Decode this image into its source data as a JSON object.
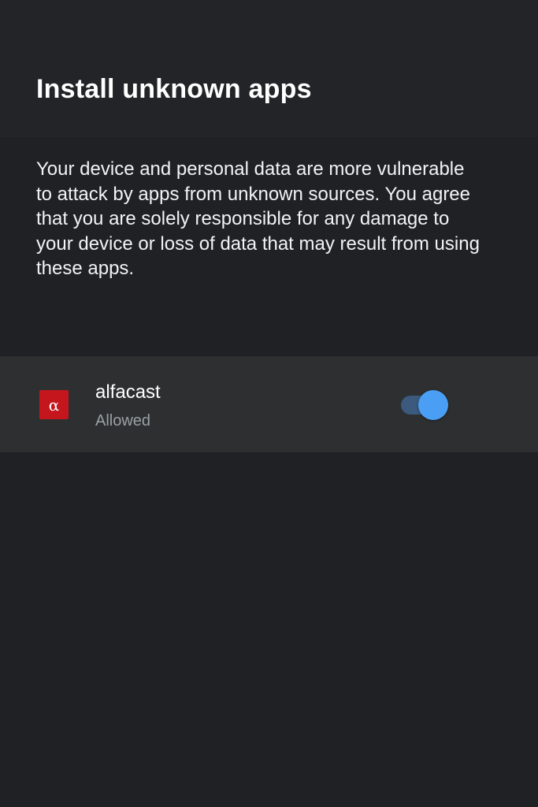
{
  "header": {
    "title": "Install unknown apps"
  },
  "warning": {
    "text": "Your device and personal data are more vulnerable to attack by apps from unknown sources. You agree that you are solely responsible for any damage to your device or loss of data that may result from using these apps."
  },
  "apps": [
    {
      "name": "alfacast",
      "status": "Allowed",
      "icon": "alpha-app-icon",
      "icon_glyph": "α",
      "icon_color": "#c4161c",
      "allowed": true
    }
  ],
  "colors": {
    "background": "#202124",
    "header_background": "#232427",
    "row_background": "#2d2f31",
    "toggle_thumb": "#4a9ff5",
    "toggle_track": "#3b5a7d",
    "secondary_text": "#9aa0a6"
  }
}
